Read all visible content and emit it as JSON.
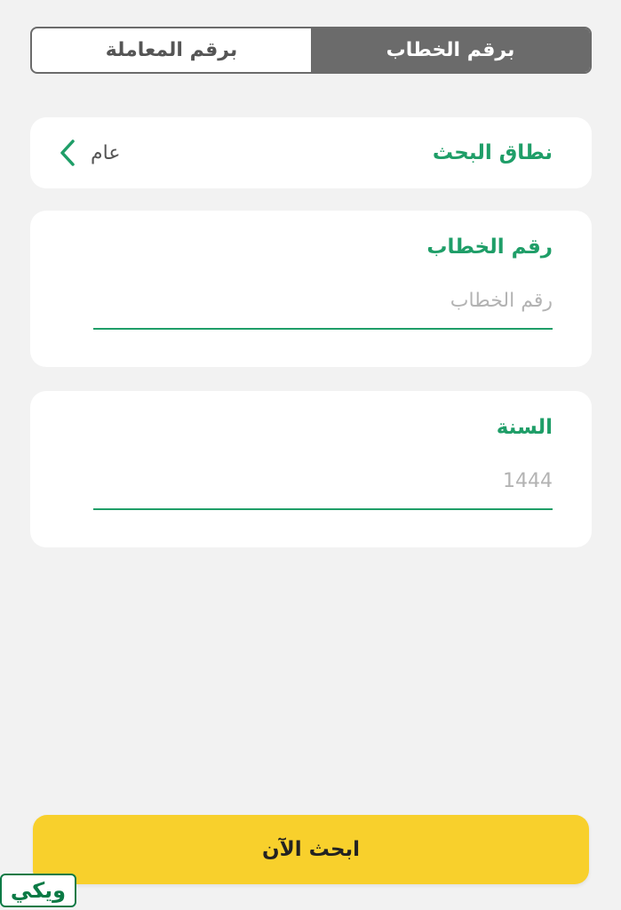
{
  "tabs": [
    {
      "label": "برقم الخطاب",
      "active": true
    },
    {
      "label": "برقم المعاملة",
      "active": false
    }
  ],
  "scope": {
    "label": "نطاق البحث",
    "value": "عام",
    "icon": "chevron-left-icon"
  },
  "letter_number": {
    "label": "رقم الخطاب",
    "placeholder": "رقم الخطاب",
    "value": ""
  },
  "year": {
    "label": "السنة",
    "placeholder": "1444",
    "value": ""
  },
  "search_button": {
    "label": "ابحث الآن"
  },
  "watermark": {
    "text": "ويكي"
  },
  "colors": {
    "accent_green": "#1f9e68",
    "tab_active": "#6b6b6b",
    "button_yellow": "#f8d02c",
    "background": "#f2f2f2"
  }
}
